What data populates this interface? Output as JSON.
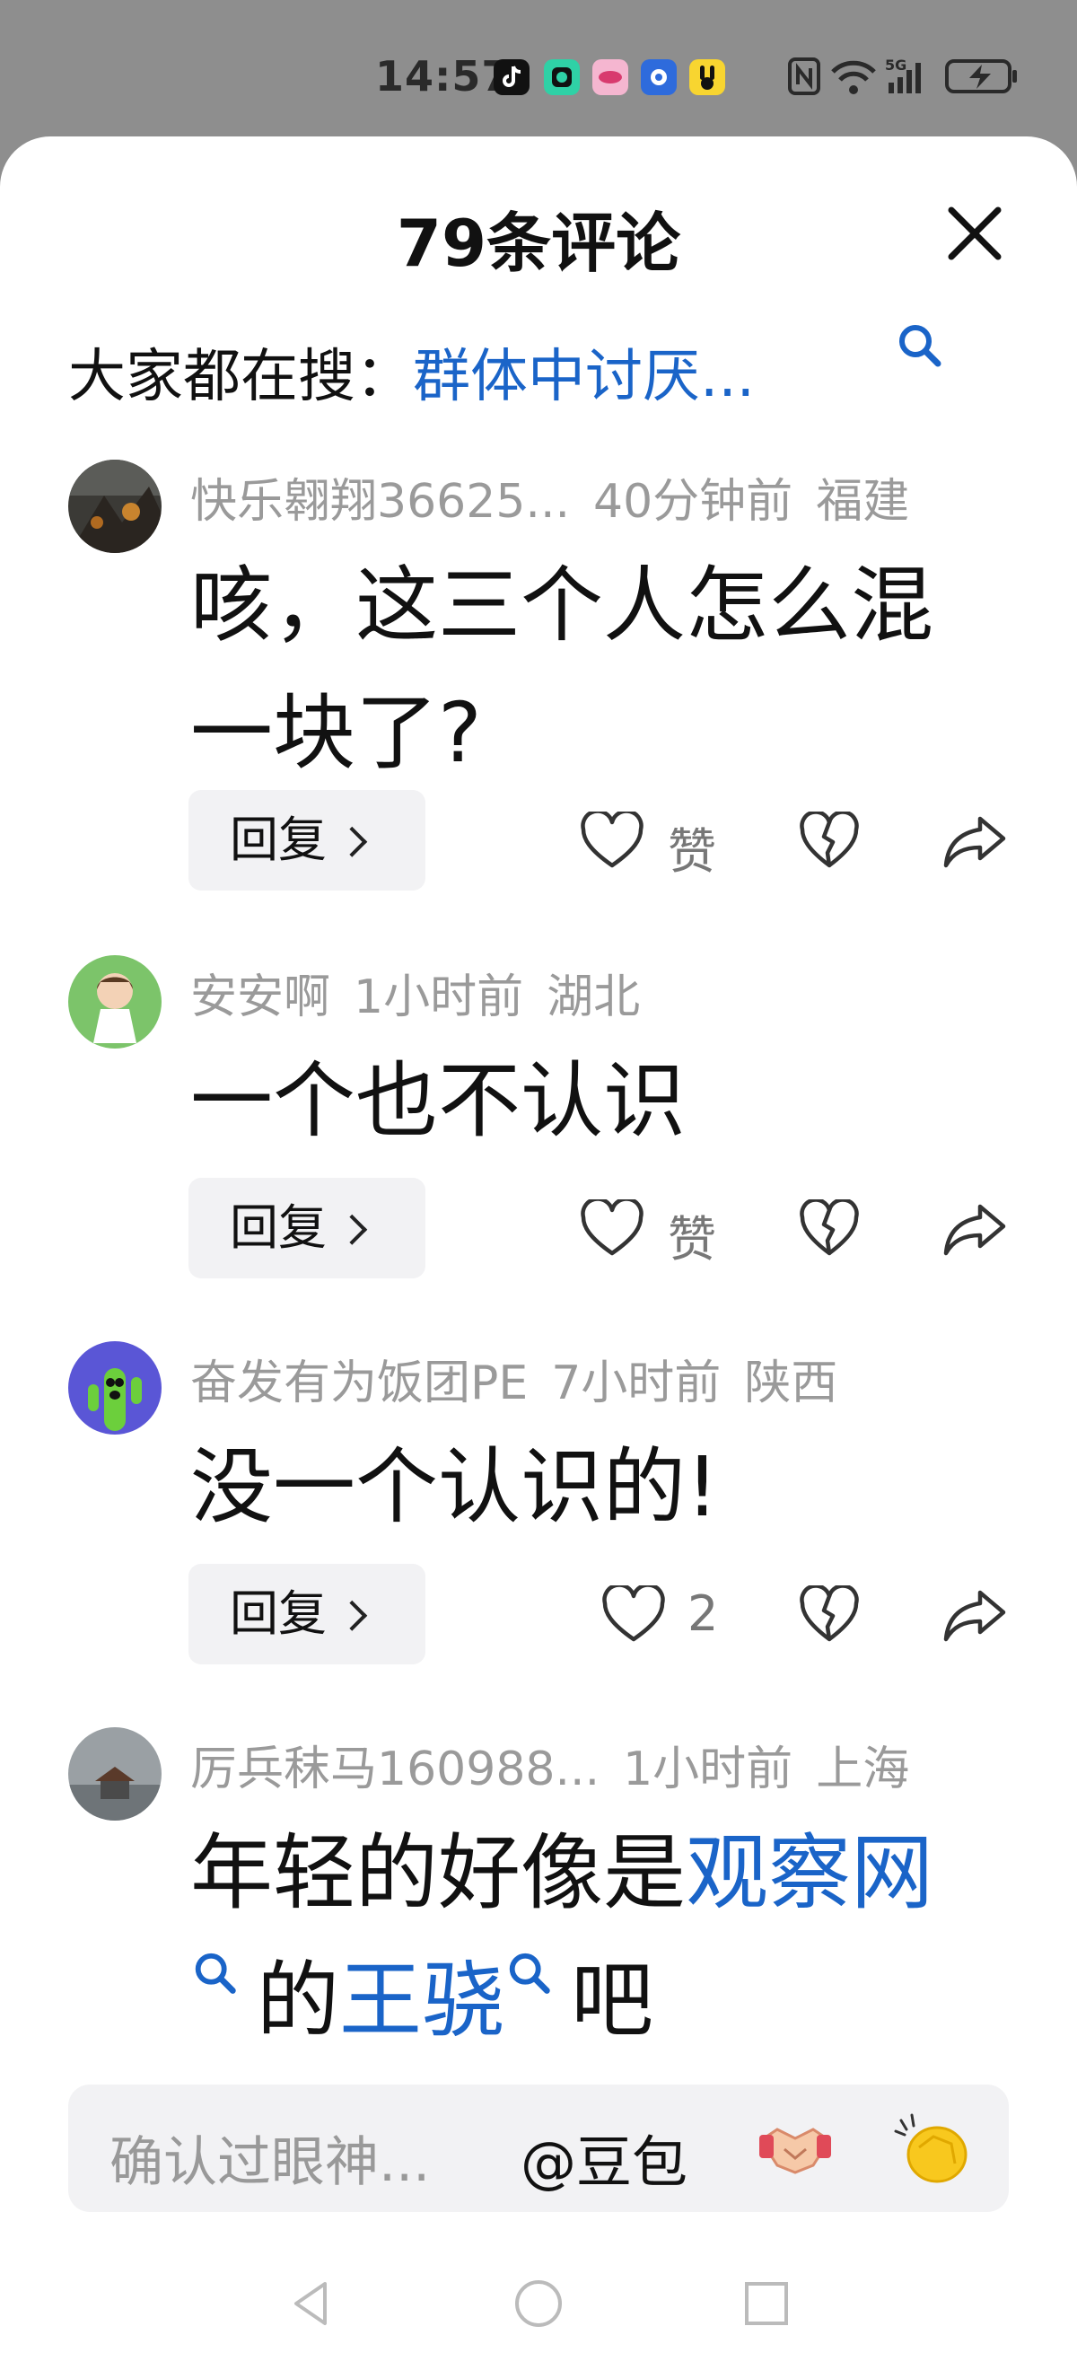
{
  "status_bar": {
    "time": "14:57",
    "network": "5G"
  },
  "header": {
    "title": "79条评论"
  },
  "trending": {
    "prefix": "大家都在搜：",
    "keyword": "群体中讨厌..."
  },
  "comments": [
    {
      "username": "快乐翱翔36625...",
      "time": "40分钟前",
      "location": "福建",
      "text": "咳，这三个人怎么混一块了?",
      "reply_label": "回复",
      "like_label": "赞"
    },
    {
      "username": "安安啊",
      "time": "1小时前",
      "location": "湖北",
      "text": "一个也不认识",
      "reply_label": "回复",
      "like_label": "赞"
    },
    {
      "username": "奋发有为饭团PE",
      "time": "7小时前",
      "location": "陕西",
      "text": "没一个认识的!",
      "reply_label": "回复",
      "like_label": "2"
    },
    {
      "username": "厉兵秣马160988...",
      "time": "1小时前",
      "location": "上海",
      "text_part1": "年轻的好像是",
      "link1": "观察网",
      "text_part2": "的",
      "link2": "王骁",
      "text_part3": "吧"
    }
  ],
  "input_bar": {
    "placeholder": "确认过眼神...",
    "mention": "@豆包",
    "handshake": "🤝"
  },
  "colors": {
    "link": "#1a64c8",
    "meta": "#9a9a9a",
    "status_bg": "#8e8e8e"
  }
}
